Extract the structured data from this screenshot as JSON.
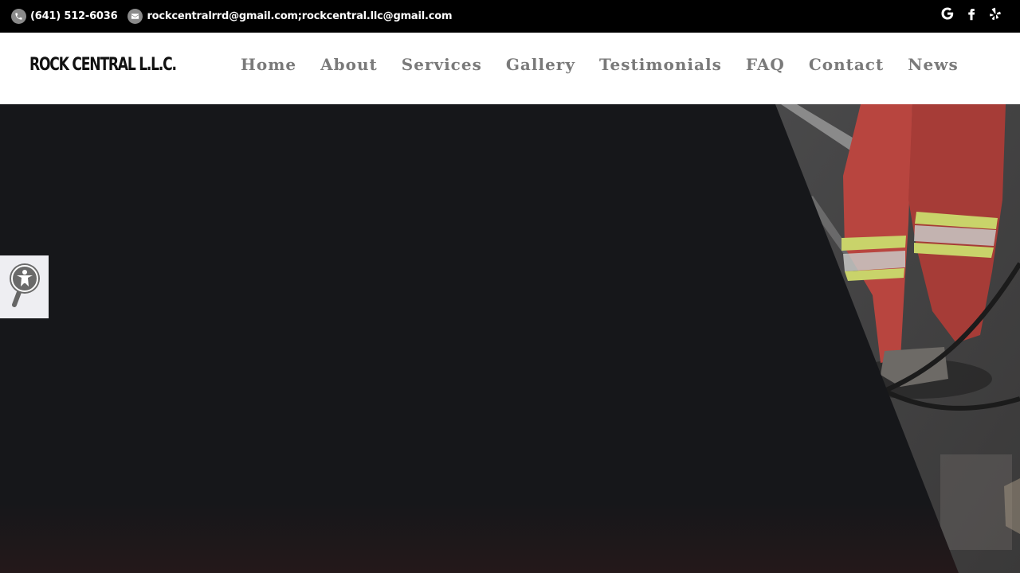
{
  "topbar": {
    "phone": "(641) 512-6036",
    "email": "rockcentralrrd@gmail.com;rockcentral.llc@gmail.com",
    "icons": [
      "phone-icon",
      "email-icon",
      "google-icon",
      "facebook-icon",
      "yelp-icon"
    ]
  },
  "header": {
    "logo": "ROCK CENTRAL L.L.C.",
    "nav": [
      "Home",
      "About",
      "Services",
      "Gallery",
      "Testimonials",
      "FAQ",
      "Contact",
      "News"
    ]
  },
  "accessibility": {
    "icon": "accessibility-icon"
  },
  "colors": {
    "topbar_bg": "#000000",
    "nav_text": "#7a7a7a",
    "hero_dark": "#16171a",
    "worker_red": "#b8453f",
    "reflective_stripe": "#c9d36a"
  }
}
